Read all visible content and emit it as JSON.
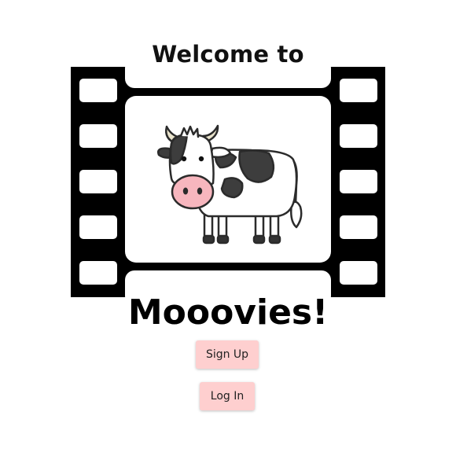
{
  "hero": {
    "welcome_text": "Welcome to",
    "brand_name": "Mooovies!",
    "image_icon": "cow-in-film-strip-illustration"
  },
  "actions": {
    "signup_label": "Sign Up",
    "login_label": "Log In"
  },
  "colors": {
    "button_bg": "#fecfcf",
    "film_strip": "#000000",
    "cow_nose": "#f7b6be"
  }
}
